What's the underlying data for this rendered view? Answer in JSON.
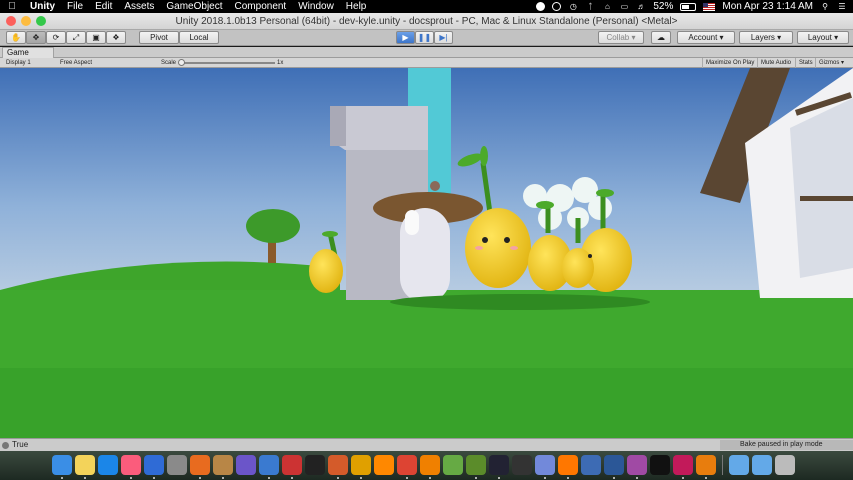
{
  "menubar": {
    "app_name": "Unity",
    "menus": [
      "File",
      "Edit",
      "Assets",
      "GameObject",
      "Component",
      "Window",
      "Help"
    ],
    "battery": "52%",
    "clock": "Mon Apr 23  1:14 AM"
  },
  "window": {
    "title": "Unity 2018.1.0b13 Personal (64bit) - dev-kyle.unity - docsprout - PC, Mac & Linux Standalone (Personal) <Metal>"
  },
  "toolbar": {
    "tools": [
      "hand-tool",
      "move-tool",
      "rotate-tool",
      "scale-tool",
      "rect-tool",
      "transform-tool"
    ],
    "pivot_label": "Pivot",
    "local_label": "Local",
    "collab_label": "Collab",
    "account_label": "Account",
    "layers_label": "Layers",
    "layout_label": "Layout",
    "play_active": true
  },
  "game_view": {
    "tab_label": "Game",
    "display": "Display 1",
    "aspect": "Free Aspect",
    "scale_label": "Scale",
    "scale_value": "1x",
    "scale_fraction": 0.0,
    "maximize_label": "Maximize On Play",
    "mute_label": "Mute Audio",
    "stats_label": "Stats",
    "gizmos_label": "Gizmos"
  },
  "status": {
    "message": "True",
    "bake_status": "Bake paused in play mode"
  },
  "dock": {
    "icons": [
      "finder-icon",
      "notes-icon",
      "app-store-icon",
      "itunes-icon",
      "xcode-icon",
      "system-preferences-icon",
      "firefox-icon",
      "guitar-icon",
      "visual-studio-icon",
      "chrome-canary-icon",
      "game-icon",
      "terminal-icon",
      "git-icon",
      "jam-icon",
      "sublime-icon",
      "chrome-icon",
      "vlc-icon",
      "minecraft-icon",
      "green-block-icon",
      "steam-icon",
      "unity-icon",
      "discord-icon",
      "fire-icon",
      "xcode-2-icon",
      "word-icon",
      "magnet-icon",
      "github-icon",
      "rider-icon",
      "blender-icon",
      "folder-icon",
      "folder-2-icon",
      "trash-icon"
    ],
    "colors": [
      "#3a8ee6",
      "#f3d35a",
      "#1b86e8",
      "#fb5c7c",
      "#2f6bd6",
      "#8a8a8a",
      "#e86b1f",
      "#b88646",
      "#6b55c9",
      "#3a7ad0",
      "#c33",
      "#222",
      "#d45b2a",
      "#e0a000",
      "#ff8800",
      "#dd4433",
      "#f08000",
      "#6a4",
      "#5b8c2a",
      "#223",
      "#333",
      "#7289da",
      "#ff7700",
      "#3d6bb4",
      "#2b5797",
      "#a04aa4",
      "#111",
      "#c21a5a",
      "#e87d0d",
      "#63a9e8",
      "#63a9e8",
      "#bbb"
    ]
  }
}
